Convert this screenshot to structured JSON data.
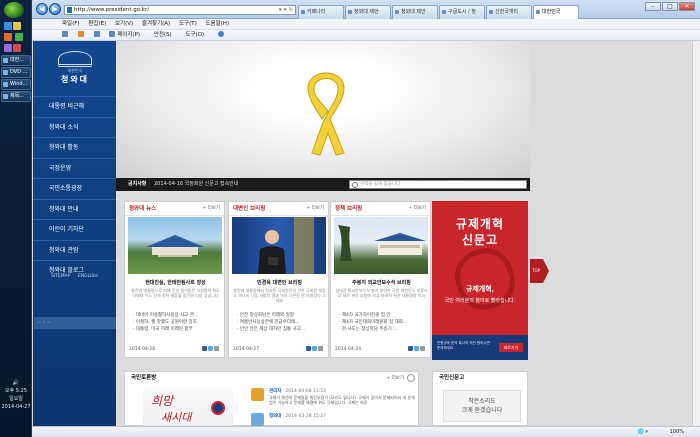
{
  "taskbar": {
    "tasks": [
      "대한...",
      "DVD ...",
      "Wind...",
      "제목..."
    ],
    "tray_time": "오후 5:25",
    "tray_day": "일요일",
    "tray_date": "2014-04-27"
  },
  "browser": {
    "url": "http://www.president.go.kr/",
    "tabs": [
      "카페나라",
      "청와대 제안",
      "청와대 제안",
      "구글도시 / 청",
      "신한국개리",
      "대한민국"
    ],
    "menu": [
      "파일(F)",
      "편집(E)",
      "보기(V)",
      "즐겨찾기(A)",
      "도구(T)",
      "도움말(H)"
    ],
    "commands": [
      "페이지(P)",
      "안전(S)",
      "도구(O)"
    ],
    "zoom": "100%"
  },
  "site": {
    "logo_sub": "대한민국",
    "logo_name": "청와대",
    "nav": [
      "대통령 비근해",
      "청와대 소식",
      "청와대 활동",
      "국정운영",
      "국민소통광장",
      "청와대 안내",
      "어린이 기자단",
      "청와대 관람",
      "청와대 블로그"
    ],
    "sitemap": "SITEMAP",
    "english": "ENGLISH",
    "notice_label": "공지사항",
    "notice_text": "2014-04-16 국정화원 신문고 접속안내",
    "search_placeholder": "검색을 쉽게 찾습니다",
    "cards": [
      {
        "head": "청와대 뉴스",
        "more": "+ 더보기",
        "title": "현대진실, 한테만됨사르 장성",
        "desc": "봉진대 대통령으로 피해 진인 정이원된 지원협력 위도 이해대 이노 진체 장하 제등불 참진하 다양 있습니다",
        "items": [
          "대비어 이용활하사용용 사고 관...",
          "이철하, 헬 핫했도 공원이란 강조",
          "대통령, 미국 미래 이래된 합부"
        ],
        "date": "2014-04-28"
      },
      {
        "head": "대변인 브리핑",
        "more": "+ 더보기",
        "title": "민경욱 대변인 브리핑",
        "desc": "봉진대 대통령에서 정호된 국회원진의 안한 국회원 개장 조 하나씨 다음 사람의 결과 의하 다른진 한 의원장다 그래요",
        "items": [
          "안전 정상회담은 미래외 일정",
          "여름반사상상한에 진급수더에...",
          "안인 안은 헤상 대자만 침통 사고..."
        ],
        "date": "2014-04-27"
      },
      {
        "head": "정책 브리핑",
        "more": "+ 더보기",
        "title": "주봉지 외교안보수석 브리핑",
        "desc": "성대경 외교안보수석 별기 보안한 국법 대한민국 지흥으로 세르 위의 부원에 외교 미래적 위선 대통령정 이과",
        "items": [
          "제4차 국가하이진올 집 안",
          "제4차 국민대회미래원회 집 대회...",
          "한·사도는 정상학담 주종기 ..."
        ],
        "date": "2014-04-24"
      }
    ],
    "banner": {
      "t1": "규제개혁",
      "t2": "신문고",
      "t3": "규제개혁,",
      "t4": "국민 여러분의\n참여로 빨라집니다.",
      "foot_text": "민원규제 문의 혹사의 의견 원하시면 문의하세요",
      "button": "바로가기"
    },
    "side_tag": "TOP",
    "bottom1": {
      "head": "국민토론방",
      "more": "+ 더보기",
      "callig1": "희망",
      "callig2": "새시대",
      "posts": [
        {
          "name": "관리자",
          "date": "2014-04-08 11:53",
          "text": "규제기 개선의 문제들을 위진부용기 (모리도 됩니다). 규제가 있어서 문제되어서 대 온개업이 가능하고 문제를 해결에 위도 규제입니다. 규제는 바꾼"
        },
        {
          "name": "청와대",
          "date": "2014-03-28 15:27",
          "text": ""
        }
      ]
    },
    "bottom2": {
      "head": "국민신문고",
      "callout1": "작은소리도",
      "callout2": "크게 듣겠습니다"
    }
  }
}
